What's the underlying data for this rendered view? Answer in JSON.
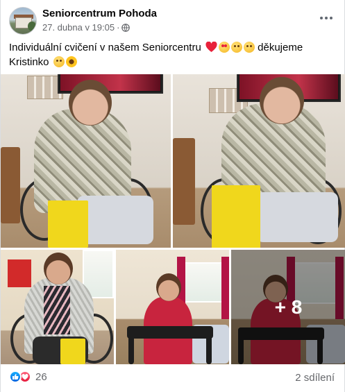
{
  "header": {
    "page_name": "Seniorcentrum Pohoda",
    "timestamp": "27. dubna v 19:05",
    "separator": "·",
    "privacy_icon": "globe-icon",
    "more_icon": "more-horizontal-icon"
  },
  "post": {
    "text": "Individuální cvičení v našem Seniorcentru",
    "text_after_emojis": "děkujeme",
    "text_line2": "Kristinko",
    "emojis_line1": [
      "red-heart",
      "heart-eyes-face",
      "hugging-face",
      "kissing-face"
    ],
    "emojis_line2": [
      "smiling-face",
      "sunflower"
    ]
  },
  "photos": {
    "count": 5,
    "more_overlay": "+ 8"
  },
  "footer": {
    "reaction_icons": [
      "like-icon",
      "love-icon"
    ],
    "reaction_count": "26",
    "shares": "2 sdílení"
  },
  "colors": {
    "like": "#0866ff",
    "love": "#f02849",
    "secondary_text": "#65676b"
  }
}
